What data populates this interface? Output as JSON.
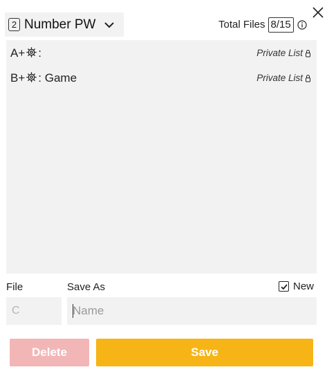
{
  "header": {
    "mode_number": "2",
    "mode_label": "Number PW",
    "total_files_label": "Total Files",
    "total_files_count": "8/15"
  },
  "list": {
    "items": [
      {
        "prefix": "A",
        "name": ":",
        "tag": "Private List"
      },
      {
        "prefix": "B",
        "name": ": Game",
        "tag": "Private List"
      }
    ]
  },
  "form": {
    "file_label": "File",
    "save_as_label": "Save As",
    "new_label": "New",
    "new_checked": true,
    "file_value": "C",
    "name_placeholder": "Name"
  },
  "buttons": {
    "delete_label": "Delete",
    "save_label": "Save"
  },
  "icons": {
    "close": "close-icon",
    "chevron": "chevron-down-icon",
    "info": "info-icon",
    "gear": "gear-icon",
    "lock": "lock-icon",
    "check": "check-icon"
  },
  "colors": {
    "panel_bg": "#f2f2f2",
    "save_button": "#f7b417",
    "delete_button": "#f3b6b6"
  }
}
